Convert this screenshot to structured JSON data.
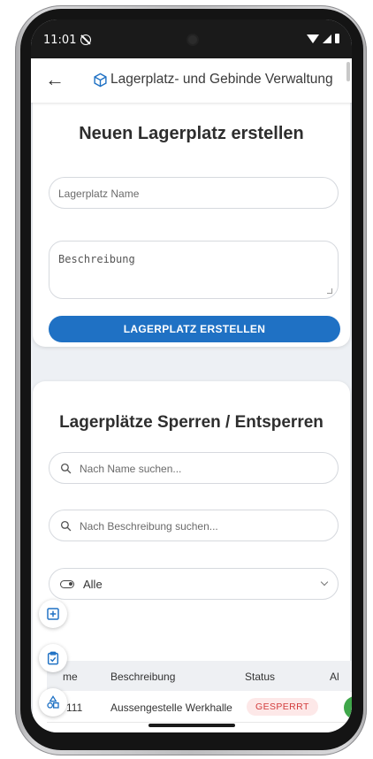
{
  "status_bar": {
    "time": "11:01"
  },
  "app_bar": {
    "title": "Lagerplatz- und Gebinde Verwaltung"
  },
  "create_card": {
    "title": "Neuen Lagerplatz erstellen",
    "name_placeholder": "Lagerplatz Name",
    "description_placeholder": "Beschreibung",
    "submit_label": "LAGERPLATZ ERSTELLEN"
  },
  "lock_card": {
    "title": "Lagerplätze Sperren / Entsperren",
    "search_name_placeholder": "Nach Name suchen...",
    "search_description_placeholder": "Nach Beschreibung suchen...",
    "filter_value": "Alle",
    "table": {
      "headers": [
        "me",
        "Beschreibung",
        "Status",
        "Al"
      ],
      "rows": [
        {
          "name": "111",
          "description": "Aussengestelle Werkhalle",
          "status": "GESPERRT"
        }
      ]
    }
  },
  "colors": {
    "primary": "#1f71c4",
    "locked_bg": "#fde8e8",
    "locked_text": "#d23c3c",
    "action_green": "#3fa74a"
  },
  "fab_icons": [
    "add-box-icon",
    "clipboard-check-icon",
    "shapes-icon"
  ]
}
